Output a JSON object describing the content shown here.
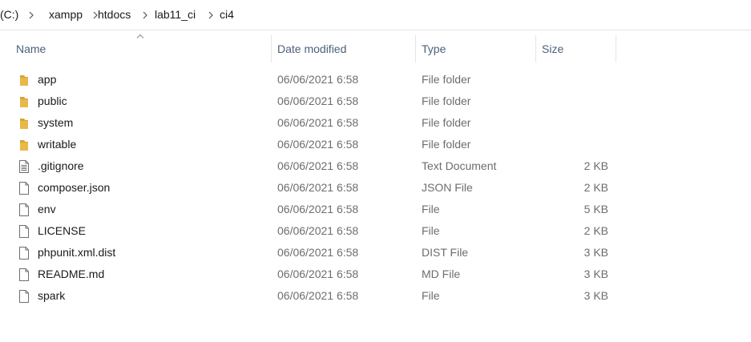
{
  "breadcrumb": {
    "items": [
      "(C:)",
      "xampp",
      "htdocs",
      "lab11_ci",
      "ci4"
    ],
    "separator_icon": "chevron-right-icon"
  },
  "columns": {
    "name": "Name",
    "date_modified": "Date modified",
    "type": "Type",
    "size": "Size",
    "sort_indicator_icon": "sort-ascending-icon"
  },
  "colors": {
    "folder": "#e8b84a",
    "folder_shade": "#d9a232",
    "header_text": "#4c607a",
    "secondary_text": "#6d6d6d"
  },
  "files": [
    {
      "name": "app",
      "date": "06/06/2021 6:58",
      "type": "File folder",
      "size": "",
      "icon": "folder-icon"
    },
    {
      "name": "public",
      "date": "06/06/2021 6:58",
      "type": "File folder",
      "size": "",
      "icon": "folder-icon"
    },
    {
      "name": "system",
      "date": "06/06/2021 6:58",
      "type": "File folder",
      "size": "",
      "icon": "folder-icon"
    },
    {
      "name": "writable",
      "date": "06/06/2021 6:58",
      "type": "File folder",
      "size": "",
      "icon": "folder-icon"
    },
    {
      "name": ".gitignore",
      "date": "06/06/2021 6:58",
      "type": "Text Document",
      "size": "2 KB",
      "icon": "text-document-icon"
    },
    {
      "name": "composer.json",
      "date": "06/06/2021 6:58",
      "type": "JSON File",
      "size": "2 KB",
      "icon": "file-icon"
    },
    {
      "name": "env",
      "date": "06/06/2021 6:58",
      "type": "File",
      "size": "5 KB",
      "icon": "file-icon"
    },
    {
      "name": "LICENSE",
      "date": "06/06/2021 6:58",
      "type": "File",
      "size": "2 KB",
      "icon": "file-icon"
    },
    {
      "name": "phpunit.xml.dist",
      "date": "06/06/2021 6:58",
      "type": "DIST File",
      "size": "3 KB",
      "icon": "file-icon"
    },
    {
      "name": "README.md",
      "date": "06/06/2021 6:58",
      "type": "MD File",
      "size": "3 KB",
      "icon": "file-icon"
    },
    {
      "name": "spark",
      "date": "06/06/2021 6:58",
      "type": "File",
      "size": "3 KB",
      "icon": "file-icon"
    }
  ]
}
